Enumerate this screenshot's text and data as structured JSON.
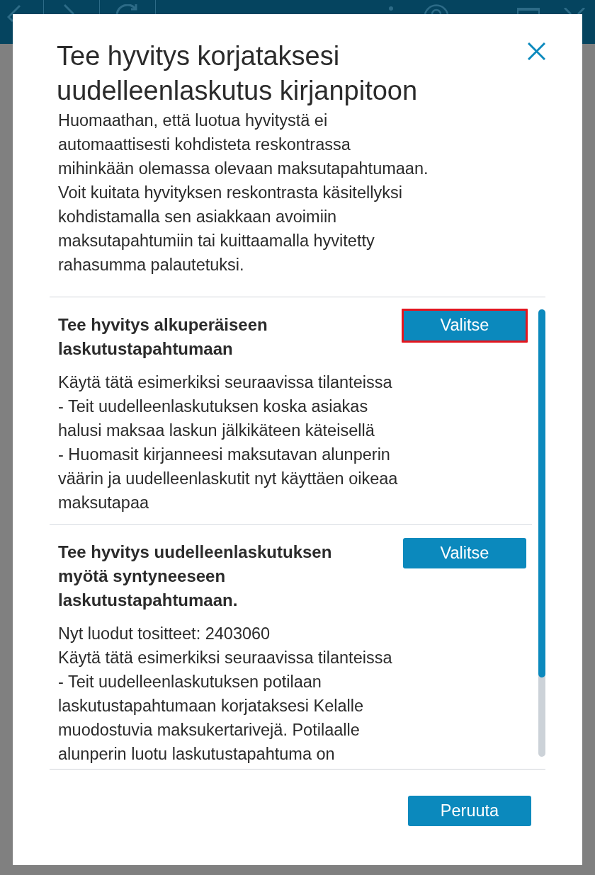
{
  "dialog": {
    "title": "Tee hyvitys korjataksesi uudelleenlaskutus kirjanpitoon",
    "message": "Huomaathan, että luotua hyvitystä ei automaattisesti kohdisteta reskontrassa mihinkään olemassa olevaan maksutapahtumaan. Voit kuitata hyvityksen reskontrasta käsitellyksi kohdistamalla sen asiakkaan avoimiin maksutapahtumiin tai kuittaamalla hyvitetty rahasumma palautetuksi."
  },
  "options": [
    {
      "title": "Tee hyvitys alkuperäiseen laskutustapahtumaan",
      "button": "Valitse",
      "highlighted": true,
      "description": [
        "Käytä tätä esimerkiksi seuraavissa tilanteissa",
        "- Teit uudelleenlaskutuksen koska asiakas halusi maksaa laskun jälkikäteen käteisellä",
        "- Huomasit kirjanneesi maksutavan alunperin väärin ja uudelleenlaskutit nyt käyttäen oikeaa maksutapaa"
      ]
    },
    {
      "title": "Tee hyvitys uudelleenlaskutuksen myötä syntyneeseen laskutustapahtumaan.",
      "button": "Valitse",
      "highlighted": false,
      "description": [
        "Nyt luodut tositteet: 2403060",
        "Käytä tätä esimerkiksi seuraavissa tilanteissa",
        "- Teit uudelleenlaskutuksen potilaan laskutustapahtumaan korjataksesi Kelalle muodostuvia maksukertarivejä. Potilaalle alunperin luotu laskutustapahtuma on"
      ]
    }
  ],
  "footer": {
    "cancel_button": "Peruuta"
  }
}
